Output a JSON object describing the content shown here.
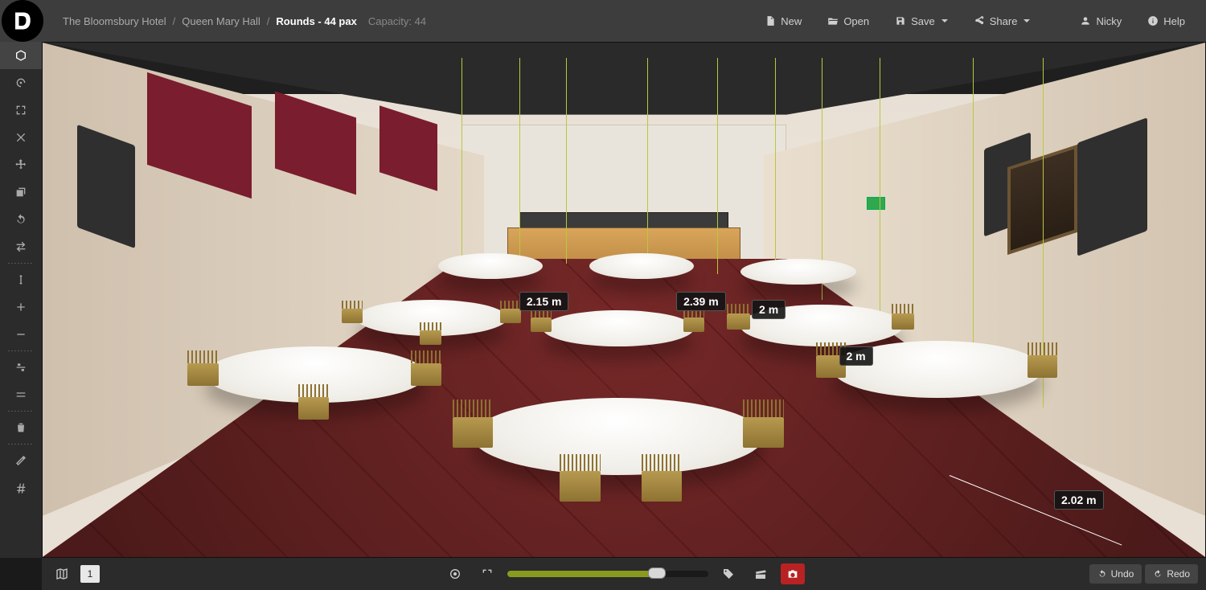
{
  "breadcrumb": {
    "hotel": "The Bloomsbury Hotel",
    "room": "Queen Mary Hall",
    "layout": "Rounds - 44 pax"
  },
  "capacity_label": "Capacity:",
  "capacity_value": "44",
  "menu": {
    "new": "New",
    "open": "Open",
    "save": "Save",
    "share": "Share",
    "user": "Nicky",
    "help": "Help"
  },
  "left_tools": {
    "view3d": "3D View",
    "orbit": "Orbit",
    "frame": "Frame",
    "close": "Close",
    "move": "Move",
    "copy": "Copy",
    "undo_rotate": "Rotate Left",
    "swap": "Swap",
    "height": "Height",
    "add": "Add",
    "remove": "Remove",
    "align": "Align",
    "layers": "Layers",
    "delete": "Delete",
    "measure": "Measure",
    "number": "Numbering"
  },
  "measurements": {
    "m1": "2.15 m",
    "m2": "2.39 m",
    "m3": "2 m",
    "m4": "2 m",
    "m5": "2.02 m"
  },
  "bottom": {
    "page": "1",
    "undo": "Undo",
    "redo": "Redo"
  }
}
